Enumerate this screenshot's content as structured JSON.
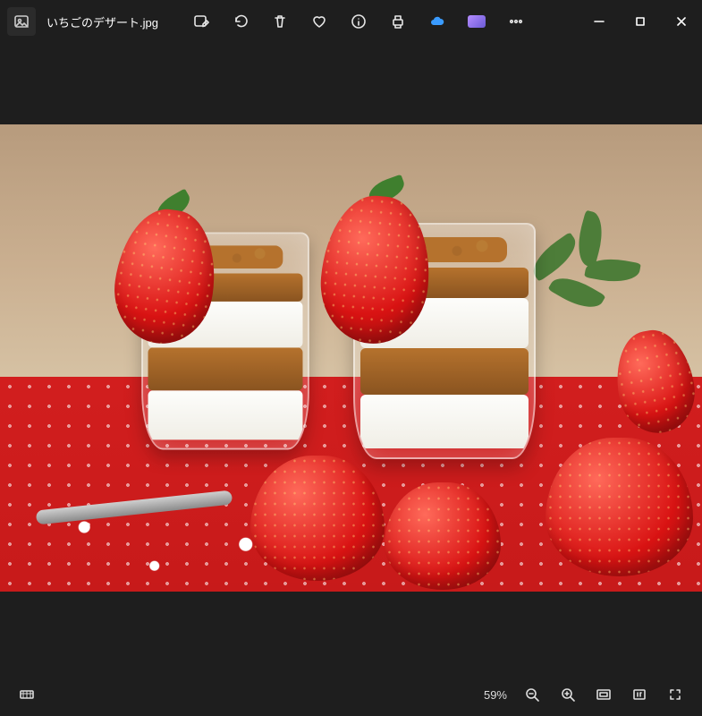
{
  "header": {
    "filename": "いちごのデザート.jpg",
    "icons": {
      "photo_thumb": "image-icon",
      "edit": "edit-image-icon",
      "rotate": "rotate-icon",
      "delete": "trash-icon",
      "favorite": "heart-icon",
      "info": "info-icon",
      "print": "print-icon",
      "cloud": "cloud-icon",
      "clipchamp": "clipchamp-icon",
      "more": "more-icon"
    },
    "window_controls": {
      "minimize": "minimize-icon",
      "maximize": "maximize-icon",
      "close": "close-icon"
    }
  },
  "statusbar": {
    "filmstrip_icon": "filmstrip-icon",
    "zoom_label": "59%",
    "zoom_out_icon": "zoom-out-icon",
    "zoom_in_icon": "zoom-in-icon",
    "fit_icon": "fit-to-window-icon",
    "actual_icon": "actual-size-icon",
    "fullscreen_icon": "fullscreen-icon"
  },
  "image": {
    "description": "Two glass cups of layered strawberry yogurt parfait with granola, topped with fresh strawberries, on a red and white polka-dot cloth with additional strawberries and a fork, wooden background."
  }
}
